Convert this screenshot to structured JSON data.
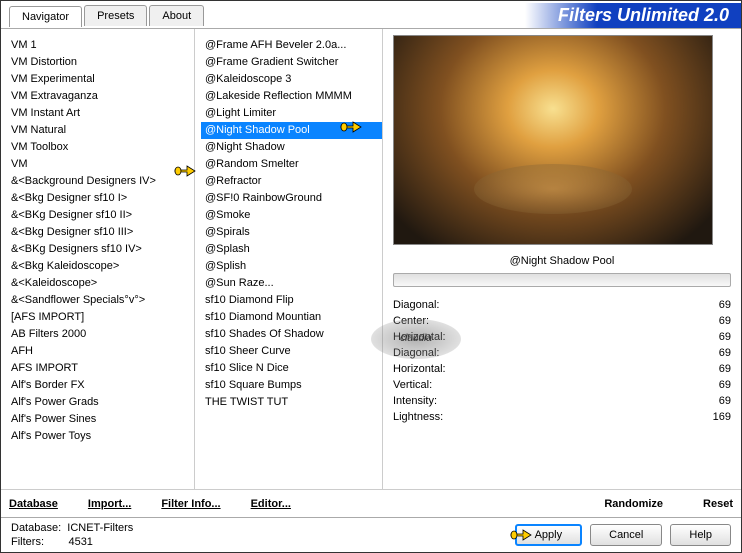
{
  "title": "Filters Unlimited 2.0",
  "tabs": [
    {
      "label": "Navigator",
      "active": true
    },
    {
      "label": "Presets",
      "active": false
    },
    {
      "label": "About",
      "active": false
    }
  ],
  "categories": [
    "VM 1",
    "VM Distortion",
    "VM Experimental",
    "VM Extravaganza",
    "VM Instant Art",
    "VM Natural",
    "VM Toolbox",
    "VM",
    "&<Background Designers IV>",
    "&<Bkg Designer sf10 I>",
    "&<BKg Designer sf10 II>",
    "&<Bkg Designer sf10 III>",
    "&<BKg Designers sf10 IV>",
    "&<Bkg Kaleidoscope>",
    "&<Kaleidoscope>",
    "&<Sandflower Specials°v°>",
    "[AFS IMPORT]",
    "AB Filters 2000",
    "AFH",
    "AFS IMPORT",
    "Alf's Border FX",
    "Alf's Power Grads",
    "Alf's Power Sines",
    "Alf's Power Toys"
  ],
  "selected_category_index": 8,
  "filters": [
    "@Frame AFH Beveler 2.0a...",
    "@Frame Gradient Switcher",
    "@Kaleidoscope 3",
    "@Lakeside Reflection MMMM",
    "@Light Limiter",
    "@Night Shadow Pool",
    "@Night Shadow",
    "@Random Smelter",
    "@Refractor",
    "@SF!0 RainbowGround",
    "@Smoke",
    "@Spirals",
    "@Splash",
    "@Splish",
    "@Sun Raze...",
    "sf10 Diamond Flip",
    "sf10 Diamond Mountian",
    "sf10 Shades Of Shadow",
    "sf10 Sheer Curve",
    "sf10 Slice N Dice",
    "sf10 Square Bumps",
    "THE TWIST TUT"
  ],
  "selected_filter_index": 5,
  "filter_name": "@Night Shadow Pool",
  "sliders": [
    {
      "label": "Diagonal:",
      "value": 69
    },
    {
      "label": "Center:",
      "value": 69
    },
    {
      "label": "Horizontal:",
      "value": 69
    },
    {
      "label": "Diagonal:",
      "value": 69
    },
    {
      "label": "Horizontal:",
      "value": 69
    },
    {
      "label": "Vertical:",
      "value": 69
    },
    {
      "label": "Intensity:",
      "value": 69
    },
    {
      "label": "Lightness:",
      "value": 169
    }
  ],
  "bottom_links": {
    "database": "Database",
    "import": "Import...",
    "filter_info": "Filter Info...",
    "editor": "Editor...",
    "randomize": "Randomize",
    "reset": "Reset"
  },
  "footer": {
    "db_label": "Database:",
    "db_value": "ICNET-Filters",
    "filters_label": "Filters:",
    "filters_value": "4531",
    "apply": "Apply",
    "cancel": "Cancel",
    "help": "Help"
  },
  "watermark": "claudia"
}
